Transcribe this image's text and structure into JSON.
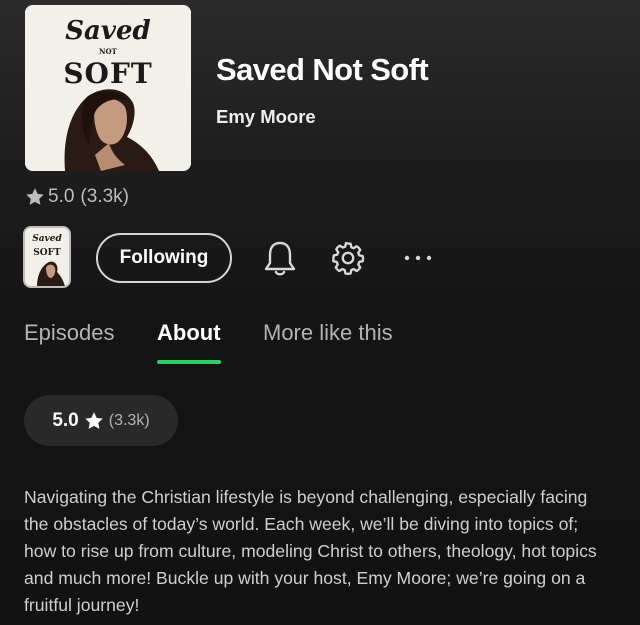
{
  "podcast": {
    "title": "Saved Not Soft",
    "author": "Emy Moore",
    "rating": "5.0",
    "rating_count": "(3.3k)",
    "cover_art": {
      "line1": "Saved",
      "line2": "NOT",
      "line3": "SOFT"
    }
  },
  "actions": {
    "follow_label": "Following",
    "icons": [
      "bell-icon",
      "gear-icon",
      "more-options-icon"
    ]
  },
  "tabs": [
    {
      "label": "Episodes",
      "active": false
    },
    {
      "label": "About",
      "active": true
    },
    {
      "label": "More like this",
      "active": false
    }
  ],
  "about": {
    "rating_pill_value": "5.0",
    "rating_pill_count": "(3.3k)",
    "description": "Navigating the Christian lifestyle is beyond challenging, especially facing the obstacles of today’s world. Each week, we’ll be diving into topics of; how to rise up from culture, modeling Christ to others, theology, hot topics and much more! Buckle up with your host, Emy Moore; we’re going on a fruitful journey!"
  },
  "colors": {
    "accent": "#1ed760",
    "background": "#121212",
    "pill": "#292929",
    "secondary_text": "#b3b3b3",
    "cover_bg": "#f3efe9"
  }
}
